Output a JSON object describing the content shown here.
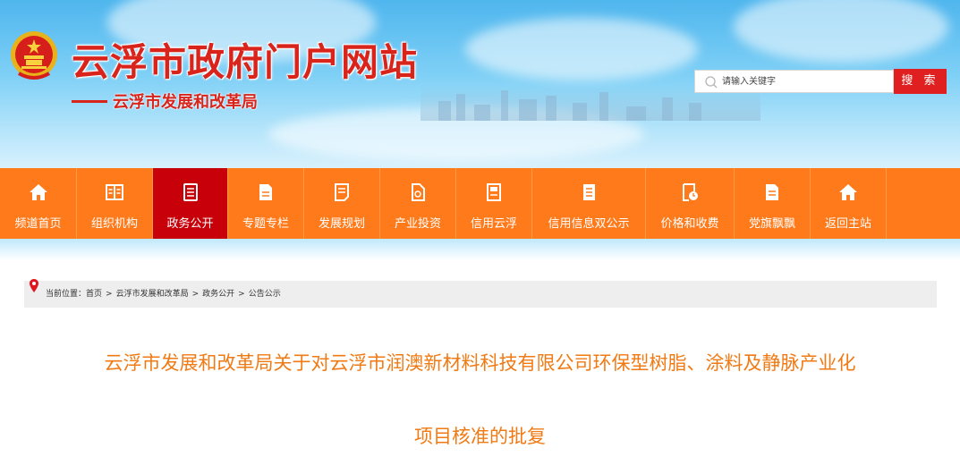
{
  "header": {
    "site_title": "云浮市政府门户网站",
    "site_subtitle": "云浮市发展和改革局",
    "emblem_icon": "national-emblem-icon"
  },
  "search": {
    "placeholder": "请输入关键字",
    "button_label": "搜 索"
  },
  "nav": {
    "items": [
      {
        "label": "频道首页",
        "icon": "home-icon"
      },
      {
        "label": "组织机构",
        "icon": "book-icon"
      },
      {
        "label": "政务公开",
        "icon": "document-icon",
        "active": true
      },
      {
        "label": "专题专栏",
        "icon": "document-icon"
      },
      {
        "label": "发展规划",
        "icon": "document-icon"
      },
      {
        "label": "产业投资",
        "icon": "document-icon"
      },
      {
        "label": "信用云浮",
        "icon": "document-icon"
      },
      {
        "label": "信用信息双公示",
        "icon": "document-icon"
      },
      {
        "label": "价格和收费",
        "icon": "document-clock-icon"
      },
      {
        "label": "党旗飘飘",
        "icon": "document-icon"
      },
      {
        "label": "返回主站",
        "icon": "home-icon"
      }
    ]
  },
  "breadcrumb": {
    "prefix": "当前位置：",
    "items": [
      "首页",
      "云浮市发展和改革局",
      "政务公开",
      "公告公示"
    ],
    "separator": ">"
  },
  "article": {
    "title_line1": "云浮市发展和改革局关于对云浮市润澳新材料科技有限公司环保型树脂、涂料及静脉产业化",
    "title_line2": "项目核准的批复"
  },
  "colors": {
    "nav_bg": "#ff7a1a",
    "nav_active": "#c8000a",
    "title_red": "#d9241c",
    "article_title": "#f07a14",
    "search_button": "#e02020"
  }
}
